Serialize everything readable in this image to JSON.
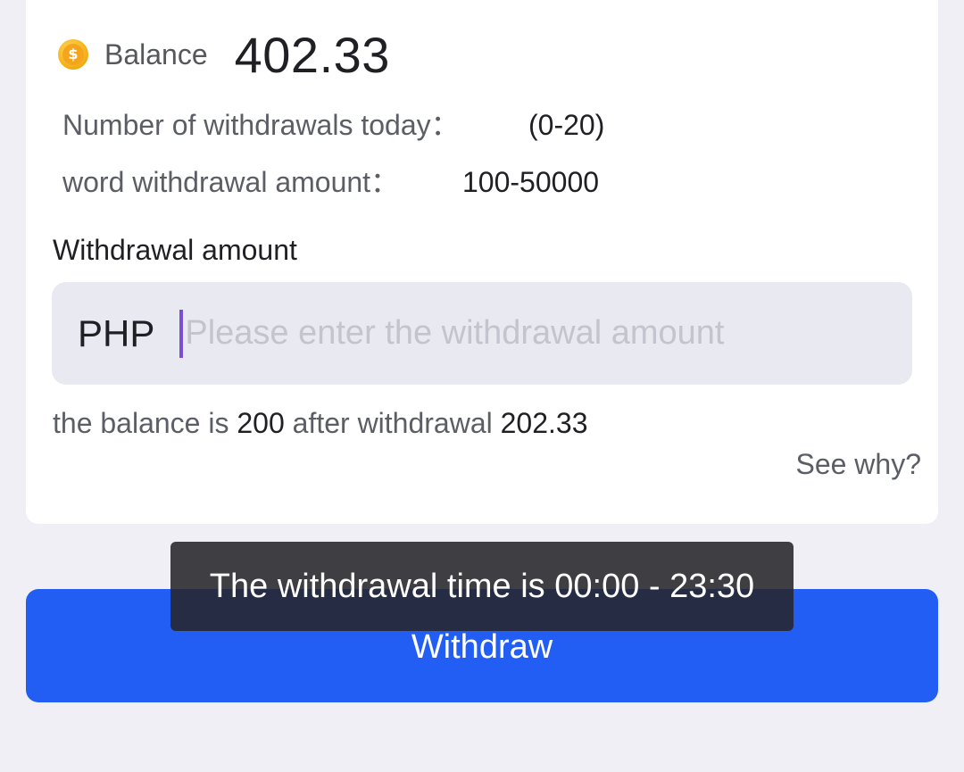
{
  "balance": {
    "icon": "coin-icon",
    "icon_symbol": "$",
    "label": "Balance",
    "value": "402.33"
  },
  "limits": {
    "count_label": "Number of withdrawals today：",
    "count_value": "(0-20)",
    "amount_label": "word withdrawal amount：",
    "amount_value": "100-50000"
  },
  "form": {
    "title": "Withdrawal amount",
    "currency": "PHP",
    "placeholder": "Please enter the withdrawal amount",
    "value": ""
  },
  "after": {
    "prefix": "the balance is ",
    "remaining": "200",
    "middle": " after withdrawal ",
    "withdrawable": "202.33"
  },
  "see_why": "See why?",
  "button": {
    "label": "Withdraw",
    "color": "#235ef4"
  },
  "toast": {
    "message": "The withdrawal time is 00:00 - 23:30"
  }
}
